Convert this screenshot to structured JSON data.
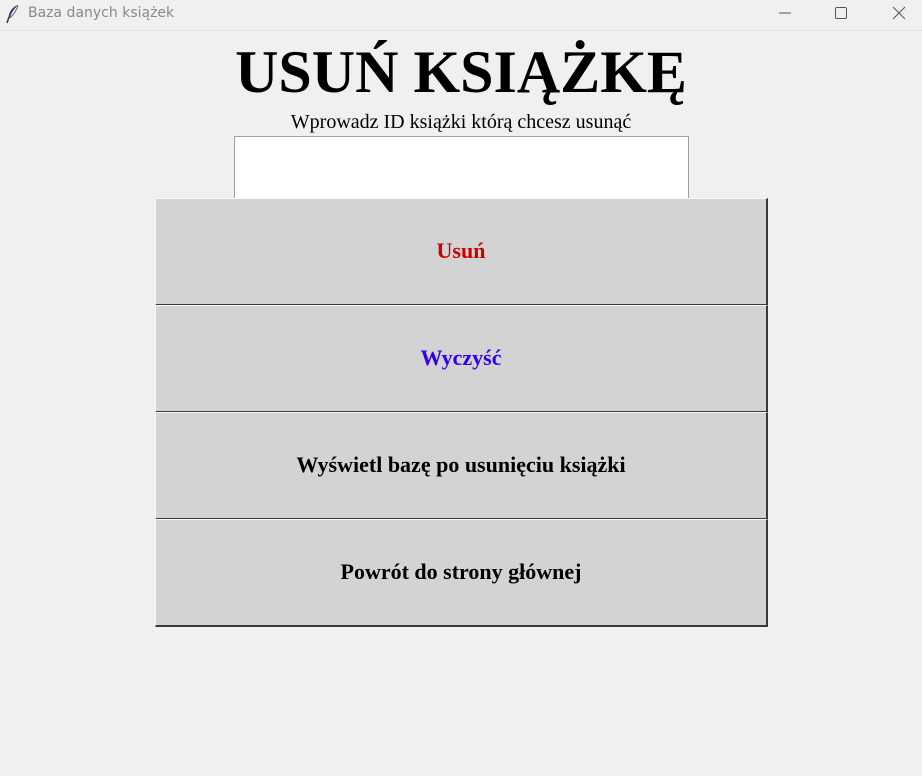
{
  "window": {
    "title": "Baza danych książek",
    "app_icon": "feather-icon",
    "controls": [
      "minimize-icon",
      "maximize-icon",
      "close-icon"
    ]
  },
  "main": {
    "heading": "USUŃ KSIĄŻKĘ",
    "prompt": "Wprowadz ID książki którą chcesz usunąć",
    "id_input": {
      "value": "",
      "placeholder": ""
    }
  },
  "buttons": {
    "delete": {
      "label": "Usuń",
      "color": "#cc0000"
    },
    "clear": {
      "label": "Wyczyść",
      "color": "#3300ee"
    },
    "show_db": {
      "label": "Wyświetl bazę po usunięciu książki",
      "color": "#000000"
    },
    "back": {
      "label": "Powrót do strony głównej",
      "color": "#000000"
    }
  },
  "colors": {
    "background": "#f0f0f0",
    "button_face": "#d3d3d3",
    "input_background": "#ffffff"
  }
}
